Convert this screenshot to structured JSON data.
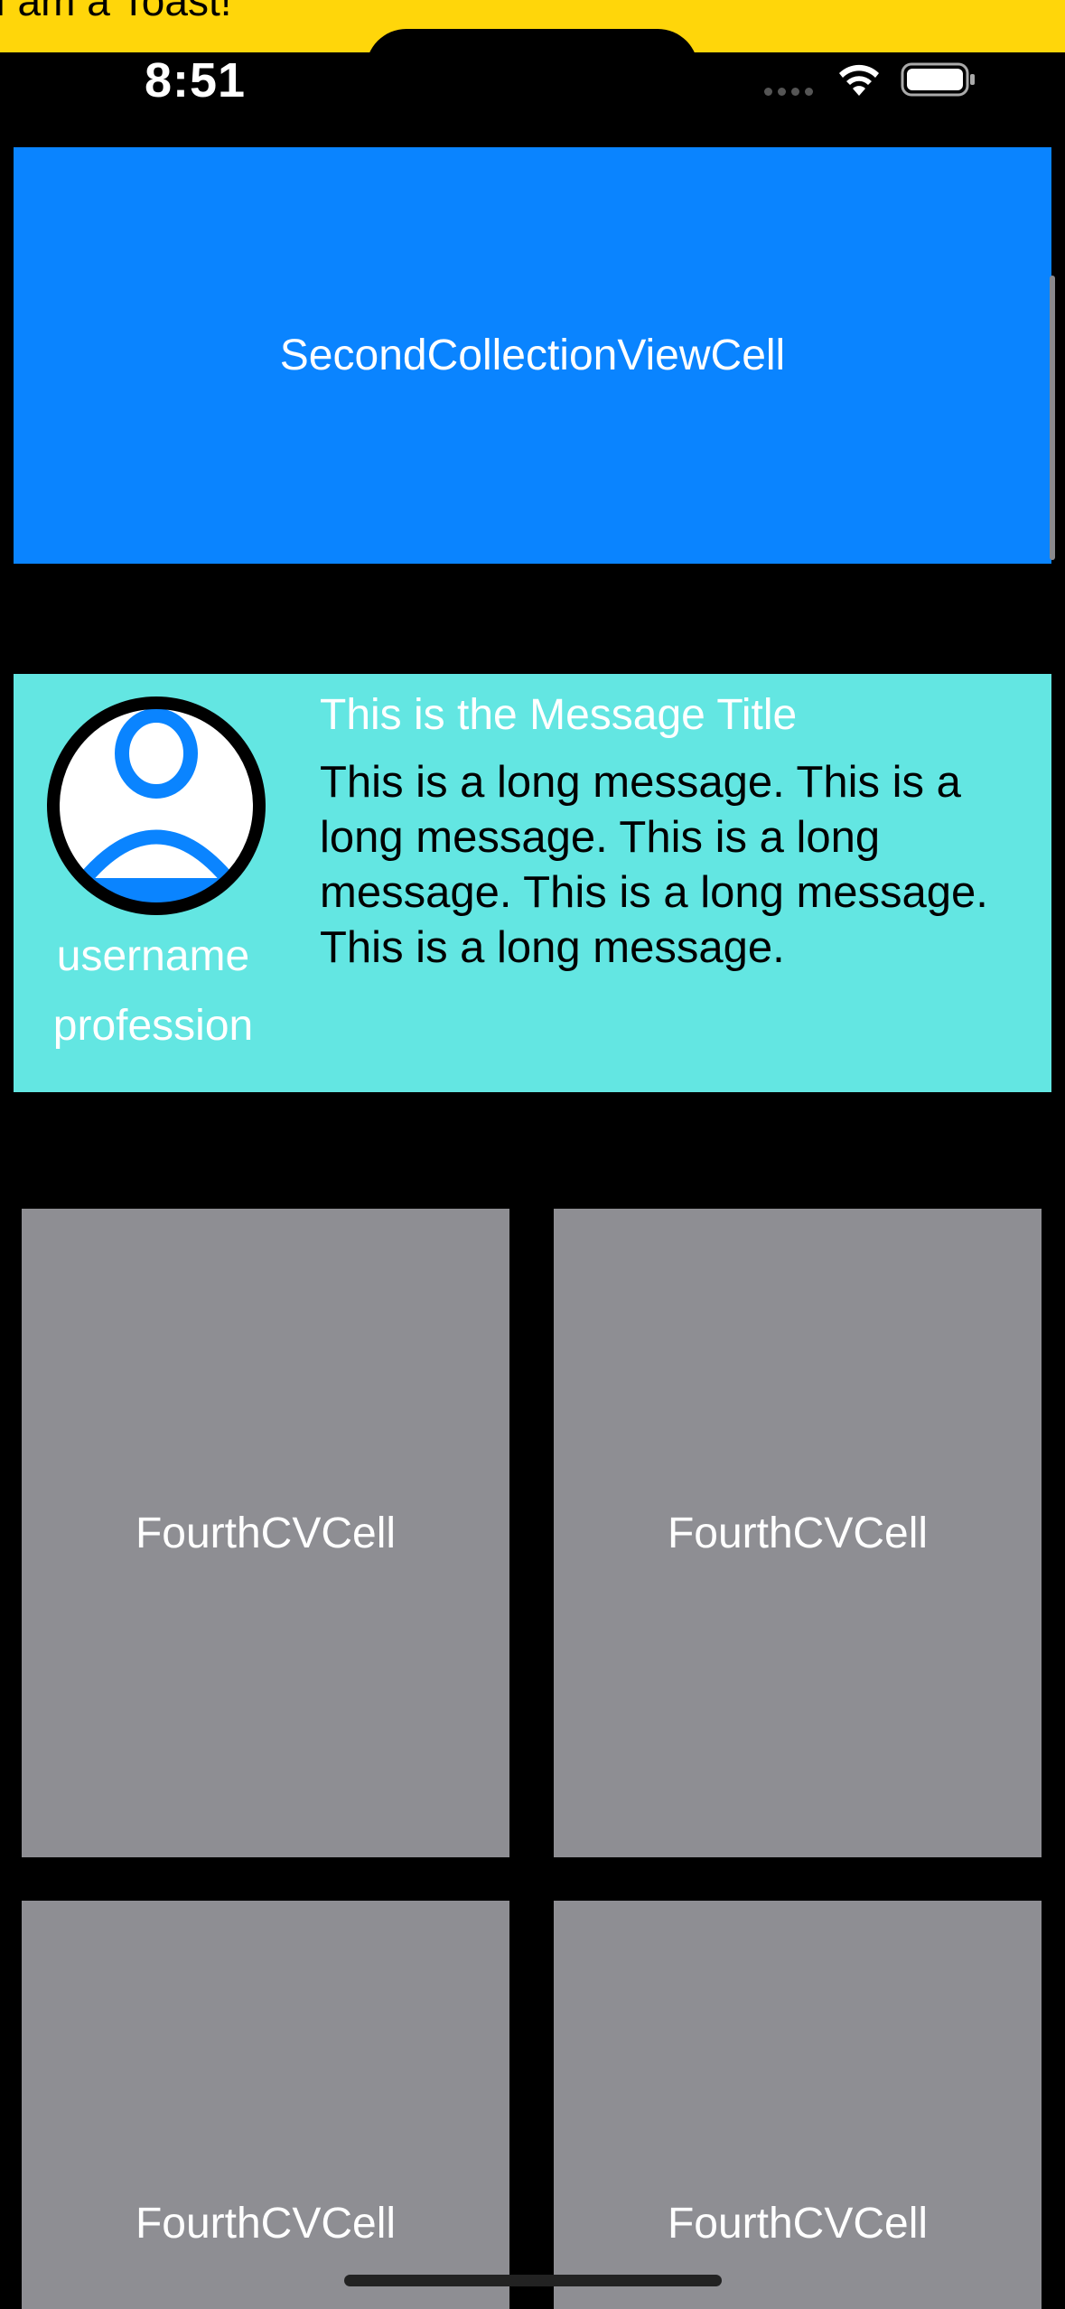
{
  "banner": {
    "text": "I am a Toast!",
    "color": "#FFD60A"
  },
  "status_bar": {
    "time": "8:51"
  },
  "second_cell": {
    "label": "SecondCollectionViewCell",
    "color": "#0A84FF"
  },
  "message_cell": {
    "color": "#63E6E2",
    "avatar_icon": "person-circle-icon",
    "username": "username",
    "profession": "profession",
    "title": "This is the Message Title",
    "body": "This is a long message. This is a long message. This is a long message. This is a long message. This is a long message."
  },
  "fourth_cells": [
    {
      "label": "FourthCVCell"
    },
    {
      "label": "FourthCVCell"
    },
    {
      "label": "FourthCVCell"
    },
    {
      "label": "FourthCVCell"
    }
  ],
  "fourth_cell_color": "#8E8E93"
}
